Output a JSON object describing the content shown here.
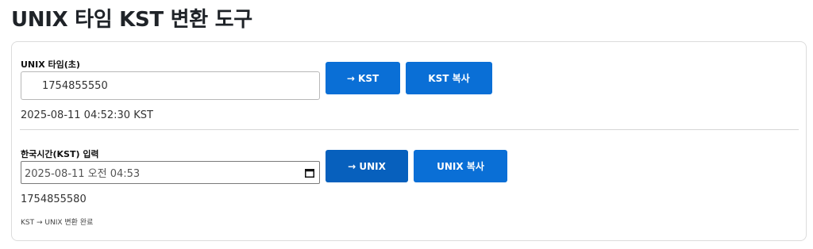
{
  "page": {
    "title": "UNIX 타임 KST 변환 도구"
  },
  "unix_section": {
    "label": "UNIX 타임(초)",
    "input_value": "1754855550",
    "to_kst_label": "→ KST",
    "copy_kst_label": "KST 복사",
    "result": "2025-08-11 04:52:30 KST"
  },
  "kst_section": {
    "label": "한국시간(KST) 입력",
    "input_value": "2025-08-11 오전 04:53",
    "to_unix_label": "→ UNIX",
    "copy_unix_label": "UNIX 복사",
    "result": "1754855580",
    "status": "KST → UNIX 변환 완료"
  },
  "icons": {
    "date_picker": "calendar-icon"
  },
  "colors": {
    "button_primary": "#0a6fd6",
    "button_active": "#0760bd",
    "card_border": "#dcdcdc"
  }
}
